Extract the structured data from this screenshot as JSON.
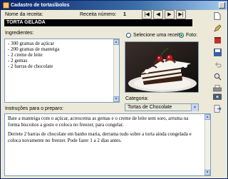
{
  "window": {
    "title": "Cadastro de tortas\\bolos"
  },
  "recipe": {
    "name_label": "Nome da receita:",
    "name_value": "TORTA GELADA",
    "number_label": "Receita número:",
    "number_value": "1"
  },
  "nav": {
    "first": "|◀",
    "prev": "◀",
    "next": "▶",
    "last": "▶|"
  },
  "ingredients": {
    "label": "Ingredientes:",
    "items": [
      "- 300 gramas de açúcar",
      "- 200 gramas de manteiga",
      "- 2 creme de leite",
      "- 2 gemas",
      "- 2 barras de chocolate"
    ]
  },
  "photo": {
    "select_label": "Selecione uma receita",
    "photo_label": "Foto:",
    "selected": "photo"
  },
  "category": {
    "label": "Categoria:",
    "value": "Tortas de Chocolate"
  },
  "instructions": {
    "label": "Instruções para o preparo:",
    "paragraphs": [
      "Bate a manteiga com o açúcar, acrescenta as gemas e o creme de leite sem soro, arruma na forma biscoitos a gosto e coloca no freezer, para congelar.",
      "Derrete 2 barras de chocolate em banho maria, derrama tudo sobre a torta ainda congelada e coloca novamente no freezer. Pode fazer 1 a 2 dias antes."
    ]
  },
  "toolbar": {
    "icons": [
      "new-document-icon",
      "edit-pencil-icon",
      "delete-icon",
      "save-icon",
      "undo-icon",
      "search-icon",
      "print-icon",
      "camera-icon",
      "exit-icon"
    ]
  },
  "colors": {
    "accent": "#0a246a",
    "field_bg": "#000000",
    "panel": "#ece9d8"
  }
}
